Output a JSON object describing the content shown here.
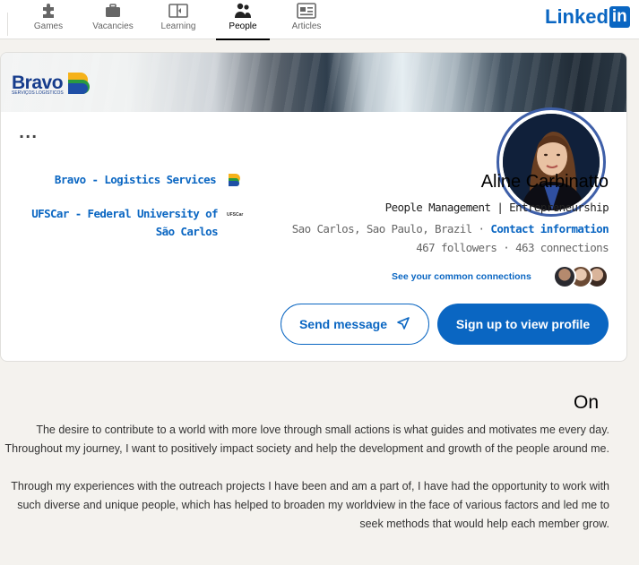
{
  "brand": {
    "logo_text": "Linked",
    "logo_in": "in"
  },
  "nav": {
    "articles": "Articles",
    "people": "People",
    "learning": "Learning",
    "vacancies": "Vacancies",
    "games": "Games"
  },
  "profile": {
    "cover_company_logo": "Bravo",
    "cover_company_tagline": "SERVIÇOS LOGÍSTICOS",
    "more_label": "...",
    "name": "Aline Carbinatto",
    "headline": "People Management | Entrepreneurship",
    "location": "Sao Carlos, Sao Paulo, Brazil",
    "separator": "·",
    "contact_info": "Contact information",
    "followers": "467 followers",
    "connections": "463 connections",
    "common_connections": "See your common connections",
    "company": "Bravo - Logistics Services",
    "school": "UFSCar - Federal University of São Carlos",
    "school_logo_text": "UFSCar",
    "signup_button": "Sign up to view profile",
    "message_button": "Send message"
  },
  "about": {
    "title": "On",
    "paragraphs": [
      "The desire to contribute to a world with more love through small actions is what guides and motivates me every day. Throughout my journey, I want to positively impact society and help the development and growth of the people around me.",
      "Through my experiences with the outreach projects I have been and am a part of, I have had the opportunity to work with such diverse and unique people, which has helped to broaden my worldview in the face of various factors and led me to seek methods that would help each member grow."
    ]
  },
  "colors": {
    "accent": "#0a66c2",
    "page_bg": "#f4f2ee",
    "card_bg": "#ffffff"
  }
}
